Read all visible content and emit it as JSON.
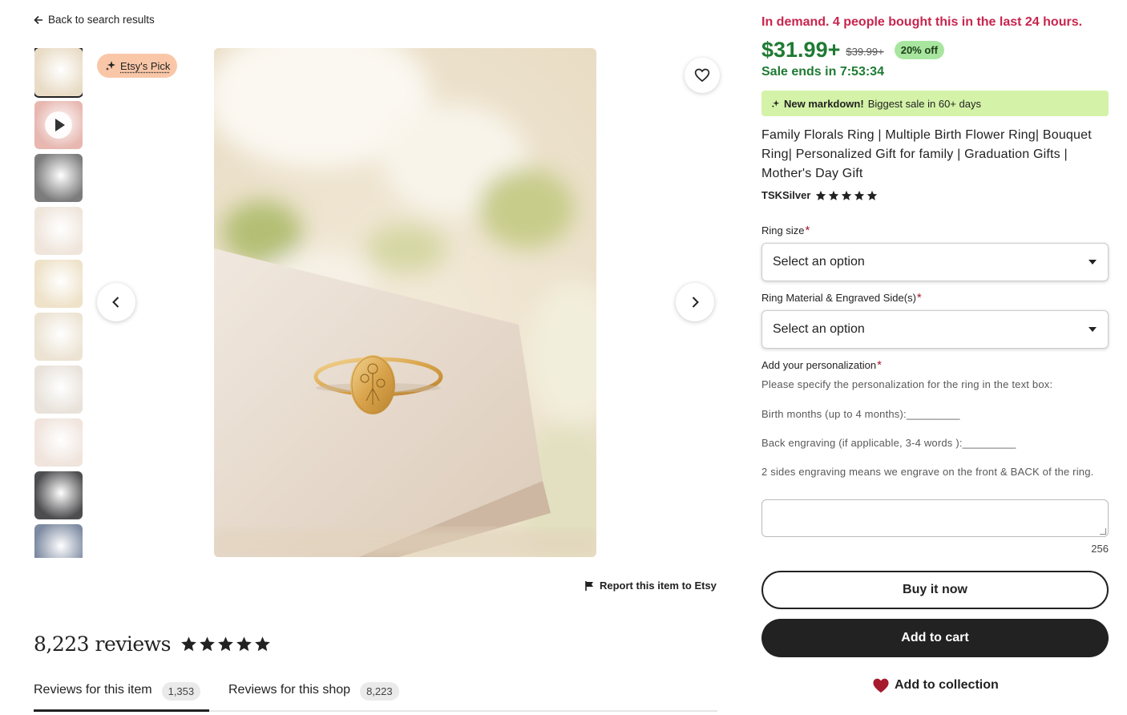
{
  "nav": {
    "back_label": "Back to search results"
  },
  "gallery": {
    "badge_label": "Etsy's Pick",
    "thumbnails": [
      {
        "name": "ring-front",
        "color": "#e9dcc6",
        "selected": true
      },
      {
        "name": "video-hand",
        "color": "#e7b7b0",
        "video": true
      },
      {
        "name": "hand-ring",
        "color": "#7c7c7c"
      },
      {
        "name": "rings-set",
        "color": "#efe5db"
      },
      {
        "name": "ring-box",
        "color": "#eee2c9"
      },
      {
        "name": "ring-stack",
        "color": "#ece3d3"
      },
      {
        "name": "gift-box",
        "color": "#e8e2da"
      },
      {
        "name": "ring-pink",
        "color": "#f0e4dc"
      },
      {
        "name": "hand-dark",
        "color": "#4d4d4f"
      },
      {
        "name": "hand-jeans",
        "color": "#7d8aa1"
      }
    ],
    "report_label": "Report this item to Etsy"
  },
  "reviews": {
    "heading": "8,223 reviews",
    "rating_stars": 5,
    "tabs": [
      {
        "label": "Reviews for this item",
        "count": "1,353"
      },
      {
        "label": "Reviews for this shop",
        "count": "8,223"
      }
    ]
  },
  "listing": {
    "demand": "In demand. 4 people bought this in the last 24 hours.",
    "price": "$31.99+",
    "original_price": "$39.99+",
    "discount": "20% off",
    "sale_ends": "Sale ends in 7:53:34",
    "markdown_bold": "New markdown!",
    "markdown_text": "Biggest sale in 60+ days",
    "title": "Family Florals Ring | Multiple Birth Flower Ring| Bouquet Ring| Personalized Gift for family | Graduation Gifts | Mother's Day Gift",
    "shop_name": "TSKSilver",
    "shop_stars": 5
  },
  "options": {
    "ring_size_label": "Ring size",
    "ring_size_value": "Select an option",
    "material_label": "Ring Material & Engraved Side(s)",
    "material_value": "Select an option",
    "required_mark": "*"
  },
  "personalization": {
    "label": "Add your personalization",
    "line1": "Please specify the personalization for the ring in the text box:",
    "line2": "Birth months (up to 4 months):_________",
    "line3": "Back engraving (if applicable, 3-4 words ):_________",
    "line4": "2 sides engraving means we engrave on the front & BACK of the ring.",
    "char_count": "256"
  },
  "actions": {
    "buy_now": "Buy it now",
    "add_to_cart": "Add to cart",
    "add_to_collection": "Add to collection"
  },
  "colors": {
    "demand_red": "#c7254e",
    "sale_green": "#1f7a33",
    "markdown_bg": "#d4f3a8",
    "badge_bg": "#f9c7a8"
  }
}
